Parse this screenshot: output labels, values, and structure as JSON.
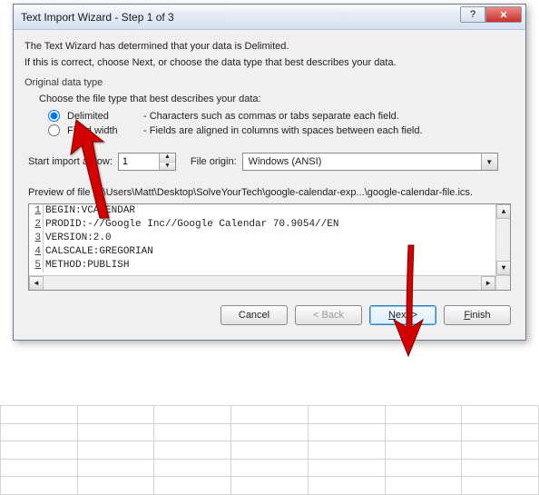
{
  "titlebar": {
    "title": "Text Import Wizard - Step 1 of 3"
  },
  "intro": {
    "line1": "The Text Wizard has determined that your data is Delimited.",
    "line2": "If this is correct, choose Next, or choose the data type that best describes your data."
  },
  "group": {
    "label": "Original data type",
    "choose": "Choose the file type that best describes your data:",
    "radios": [
      {
        "label": "Delimited",
        "desc": "- Characters such as commas or tabs separate each field.",
        "checked": true
      },
      {
        "label": "Fixed width",
        "desc": "- Fields are aligned in columns with spaces between each field.",
        "checked": false
      }
    ]
  },
  "controls": {
    "start_label": "Start import at row:",
    "start_value": "1",
    "origin_label": "File origin:",
    "origin_value": "Windows (ANSI)"
  },
  "preview": {
    "label": "Preview of file C:\\Users\\Matt\\Desktop\\SolveYourTech\\google-calendar-exp...\\google-calendar-file.ics.",
    "lines": [
      "BEGIN:VCALENDAR",
      "PRODID:-//Google Inc//Google Calendar 70.9054//EN",
      "VERSION:2.0",
      "CALSCALE:GREGORIAN",
      "METHOD:PUBLISH"
    ]
  },
  "buttons": {
    "cancel": "Cancel",
    "back": "< Back",
    "next": "Next >",
    "finish": "Finish"
  }
}
